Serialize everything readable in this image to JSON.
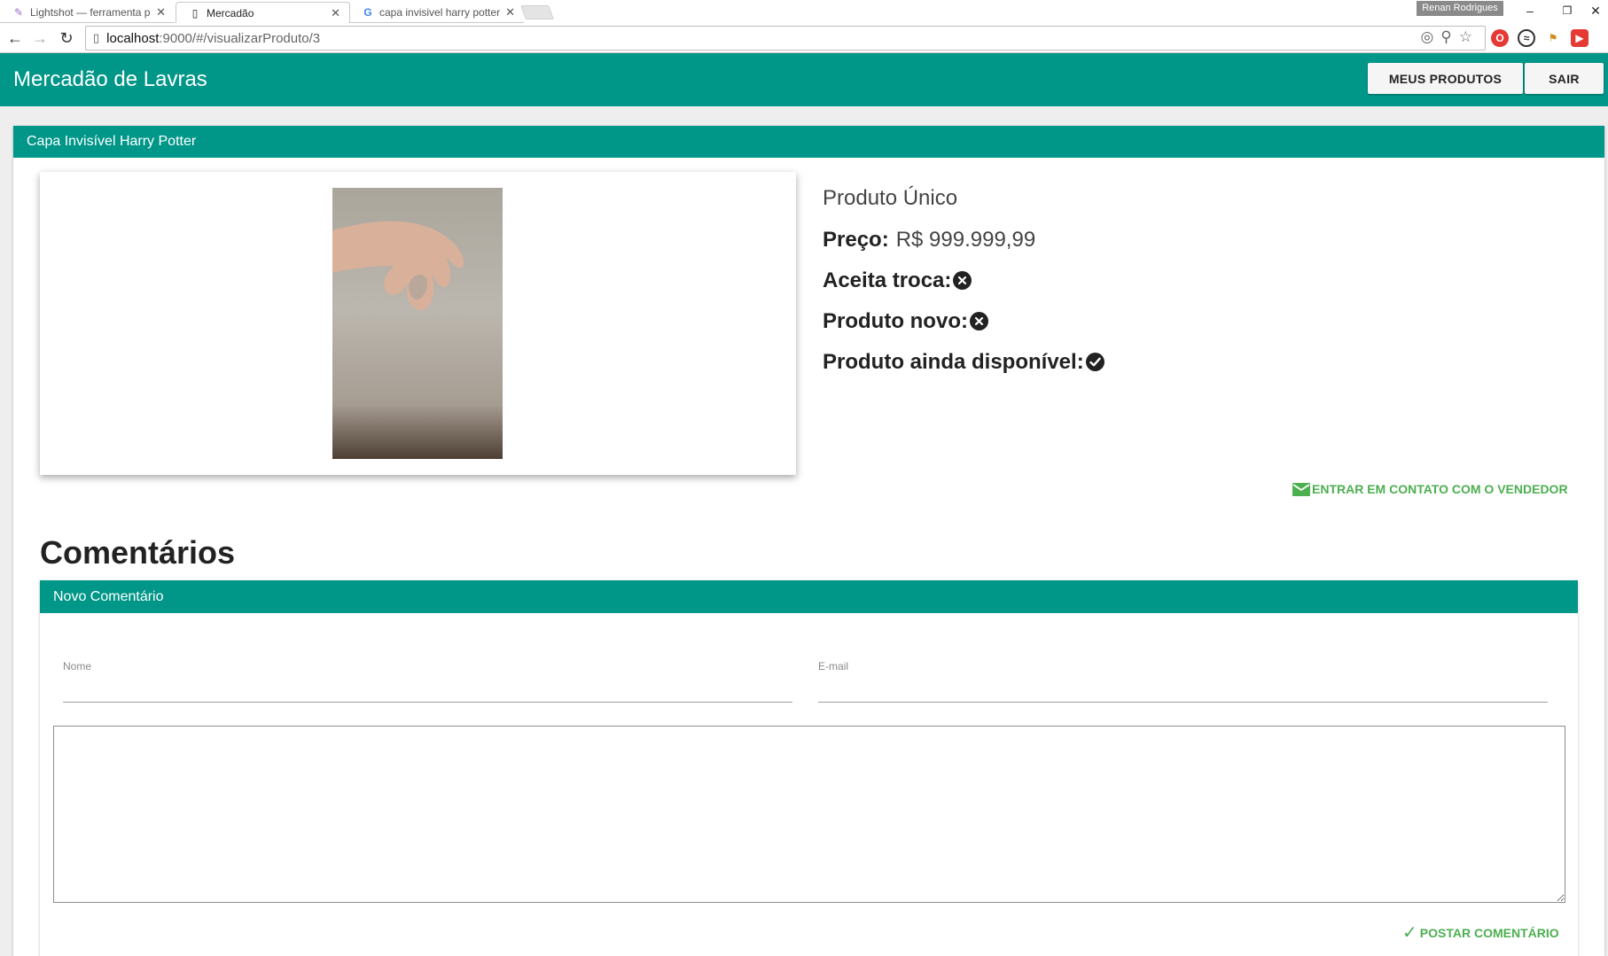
{
  "browser": {
    "tabs": [
      {
        "title": "Lightshot — ferramenta p",
        "icon": "pen-icon"
      },
      {
        "title": "Mercadão",
        "icon": "page-icon"
      },
      {
        "title": "capa invisivel harry potter",
        "icon": "google-icon"
      }
    ],
    "profile_name": "Renan Rodrigues",
    "url_host": "localhost",
    "url_path": ":9000/#/visualizarProduto/3"
  },
  "appbar": {
    "title": "Mercadão de Lavras",
    "my_products_label": "MEUS PRODUTOS",
    "logout_label": "SAIR"
  },
  "product": {
    "header": "Capa Invisível Harry Potter",
    "name": "Produto Único",
    "price_label": "Preço:",
    "price_value": "R$ 999.999,99",
    "accepts_trade_label": "Aceita troca:",
    "accepts_trade": false,
    "is_new_label": "Produto novo:",
    "is_new": false,
    "available_label": "Produto ainda disponível:",
    "available": true,
    "contact_label": "ENTRAR EM CONTATO COM O VENDEDOR"
  },
  "comments": {
    "title": "Comentários",
    "form_header": "Novo Comentário",
    "name_label": "Nome",
    "name_value": "",
    "email_label": "E-mail",
    "email_value": "",
    "text_value": "",
    "post_label": "POSTAR COMENTÁRIO"
  },
  "colors": {
    "primary": "#009688",
    "accent": "#4caf50"
  }
}
